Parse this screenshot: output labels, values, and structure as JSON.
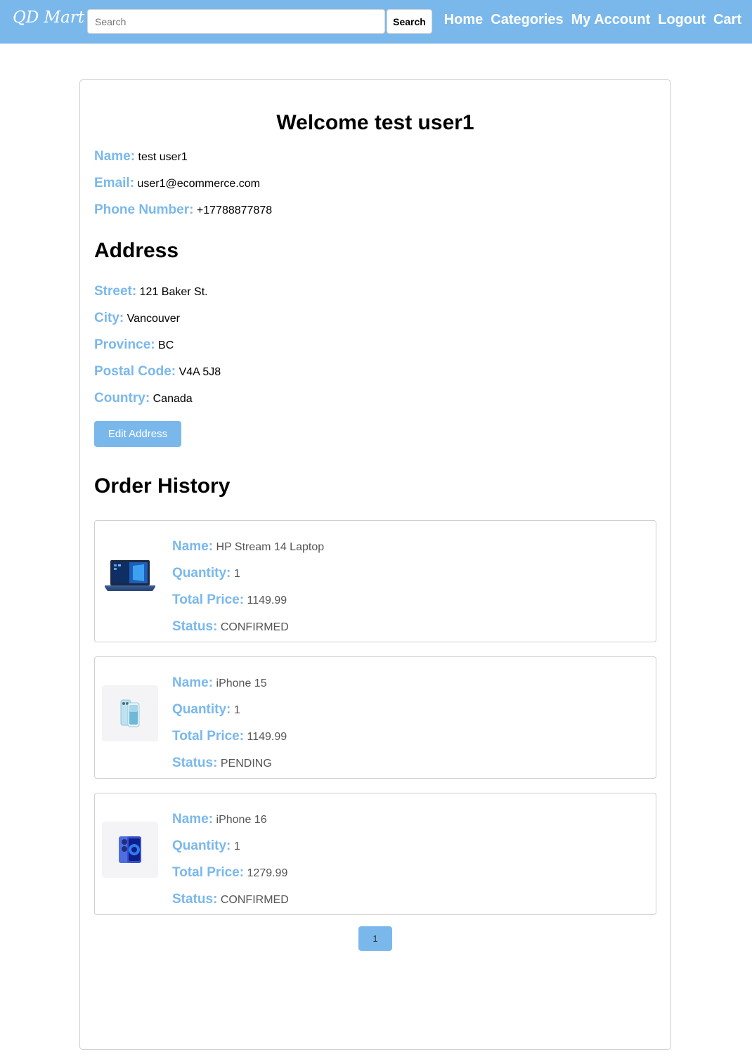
{
  "header": {
    "logo": "QD Mart",
    "search": {
      "placeholder": "Search",
      "button_label": "Search"
    },
    "nav": [
      "Home",
      "Categories",
      "My Account",
      "Logout",
      "Cart"
    ]
  },
  "account": {
    "welcome": "Welcome test user1",
    "fields": [
      {
        "label": "Name:",
        "value": "test user1"
      },
      {
        "label": "Email:",
        "value": "user1@ecommerce.com"
      },
      {
        "label": "Phone Number:",
        "value": "+17788877878"
      }
    ]
  },
  "address": {
    "heading": "Address",
    "fields": [
      {
        "label": "Street:",
        "value": "121 Baker St."
      },
      {
        "label": "City:",
        "value": "Vancouver"
      },
      {
        "label": "Province:",
        "value": "BC"
      },
      {
        "label": "Postal Code:",
        "value": "V4A 5J8"
      },
      {
        "label": "Country:",
        "value": "Canada"
      }
    ],
    "edit_button": "Edit Address"
  },
  "orders": {
    "heading": "Order History",
    "labels": {
      "name": "Name:",
      "quantity": "Quantity:",
      "total": "Total Price:",
      "status": "Status:"
    },
    "items": [
      {
        "name": "HP Stream 14 Laptop",
        "quantity": "1",
        "total": "1149.99",
        "status": "CONFIRMED",
        "icon": "laptop-icon"
      },
      {
        "name": "iPhone 15",
        "quantity": "1",
        "total": "1149.99",
        "status": "PENDING",
        "icon": "phone-icon"
      },
      {
        "name": "iPhone 16",
        "quantity": "1",
        "total": "1279.99",
        "status": "CONFIRMED",
        "icon": "phone-icon"
      }
    ]
  },
  "pagination": {
    "current": "1"
  },
  "colors": {
    "accent": "#7ab8ec"
  }
}
